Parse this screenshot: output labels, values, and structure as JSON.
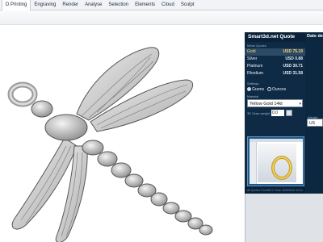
{
  "menubar": {
    "items": [
      "D Printing",
      "Engraving",
      "Render",
      "Analyse",
      "Selection",
      "Elements",
      "Cloud",
      "Sculpt"
    ],
    "active_index": 0
  },
  "quote_panel": {
    "title": "Smart3d.net Quote",
    "section_metal": "Metal Quotes",
    "metals": [
      {
        "name": "Gold",
        "price": "USD 75.19",
        "highlight": true
      },
      {
        "name": "Silver",
        "price": "USD 0.88",
        "highlight": false
      },
      {
        "name": "Platinum",
        "price": "USD 30.71",
        "highlight": false
      },
      {
        "name": "Rhodium",
        "price": "USD 31.58",
        "highlight": false
      }
    ],
    "settings_label": "Settings",
    "unit_grams": "Grams",
    "unit_ounces": "Ounces",
    "selected_unit": "Grams",
    "material_label": "Material",
    "material_value": "Yellow Gold 14kt",
    "weight_label": "3D Scan weight",
    "weight_value": "0.0",
    "footer_left": "All Quotes Fixed",
    "footer_right": "NYC Time: 8/29/2016 10:31"
  },
  "right_strip": {
    "date_label": "Date de",
    "side_label": "Weight",
    "currency_value": "US"
  },
  "colors": {
    "panel_bg": "#0e2a45",
    "gold_text": "#ffd86b",
    "model_gray": "#b9b9b9"
  }
}
